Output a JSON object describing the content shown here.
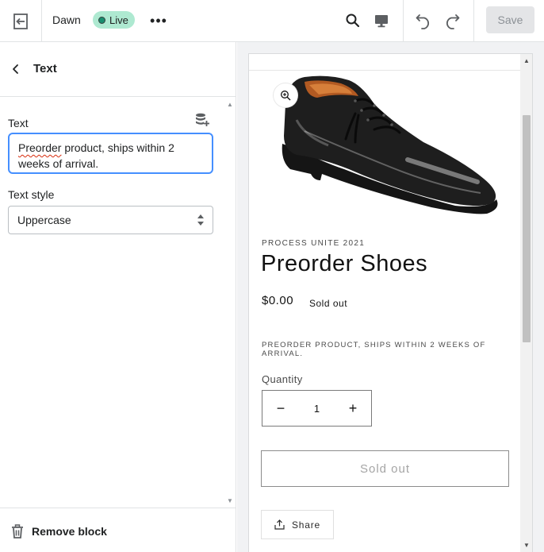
{
  "topbar": {
    "theme_name": "Dawn",
    "live_label": "Live",
    "more_label": "•••",
    "save_label": "Save",
    "icons": [
      "exit-icon",
      "search-icon",
      "desktop-icon",
      "undo-icon",
      "redo-icon"
    ]
  },
  "panel": {
    "title": "Text",
    "text_field": {
      "label": "Text",
      "value_misspelled": "Preorder",
      "value_rest": " product, ships within 2 weeks of arrival."
    },
    "style_field": {
      "label": "Text style",
      "selected": "Uppercase"
    },
    "remove_label": "Remove block"
  },
  "preview": {
    "vendor": "PROCESS UNITE 2021",
    "product_title": "Preorder Shoes",
    "price": "$0.00",
    "badge": "Sold out",
    "block_text": "Preorder product, ships within 2 weeks of arrival.",
    "quantity_label": "Quantity",
    "quantity_value": "1",
    "minus_label": "−",
    "plus_label": "+",
    "sold_out_button": "Sold out",
    "share_label": "Share"
  },
  "colors": {
    "live_badge": "#aee9d1",
    "focus_border": "#458fff",
    "save_disabled": "#e4e5e7"
  }
}
